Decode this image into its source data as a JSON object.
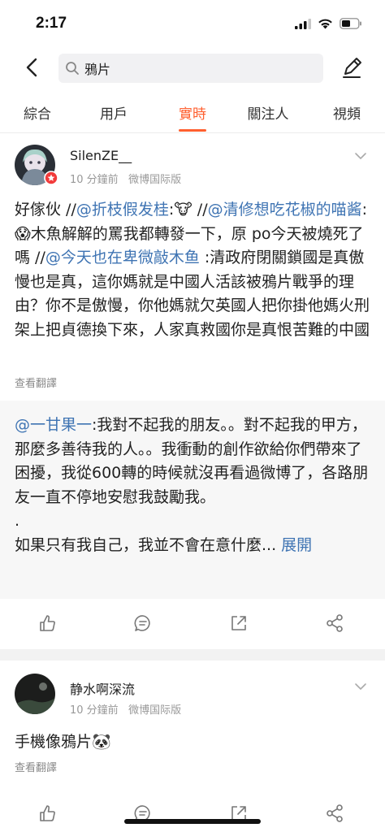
{
  "status_bar": {
    "time": "2:17",
    "icons": [
      "signal-icon",
      "wifi-icon",
      "battery-icon"
    ]
  },
  "nav": {
    "back_icon": "back-chevron-icon",
    "search_query": "鴉片",
    "search_icon": "search-icon",
    "compose_icon": "compose-icon"
  },
  "tabs": [
    {
      "label": "綜合"
    },
    {
      "label": "用戶"
    },
    {
      "label": "實時"
    },
    {
      "label": "關注人"
    },
    {
      "label": "視頻"
    }
  ],
  "active_tab": "實時",
  "accent_color": "#ff5f2f",
  "link_color": "#3f74b3",
  "posts": [
    {
      "username": "SilenZE__",
      "time": "10 分鐘前",
      "source": "微博国际版",
      "text_parts": [
        "好傢伙 //",
        "@折枝假发桂",
        ":🐮 //",
        "@清修想吃花椒的喵酱",
        ":😱木魚解解的罵我都轉發一下，原 po今天被燒死了嗎 //",
        "@今天也在卑微敲木鱼",
        " :清政府閉關鎖國是真傲慢也是真，這你媽就是中國人活該被鴉片戰爭的理由？你不是傲慢，你他媽就欠英國人把你掛他媽火刑架上把貞德換下來，人家真救國你是真恨苦難的中國"
      ],
      "translate_label": "查看翻譯",
      "repost": {
        "mention": "@一甘果一",
        "text": ":我對不起我的朋友。。對不起我的甲方，那麼多善待我的人。。我衝動的創作欲給你們帶來了困擾，我從600轉的時候就沒再看過微博了，各路朋友一直不停地安慰我鼓勵我。",
        "dot": ".",
        "last_line": "如果只有我自己，我並不會在意什麼...",
        "expand_label": "展開"
      }
    },
    {
      "username": "静水啊深流",
      "time": "10 分鐘前",
      "source": "微博国际版",
      "text": "手機像鴉片🐼",
      "translate_label": "查看翻譯"
    }
  ],
  "actions": [
    "like-icon",
    "comment-icon",
    "share-icon",
    "forward-icon"
  ]
}
